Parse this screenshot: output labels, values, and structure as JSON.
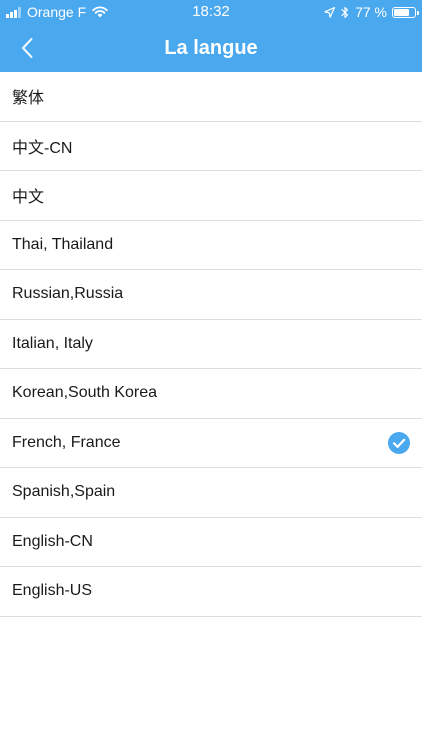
{
  "status_bar": {
    "carrier": "Orange F",
    "time": "18:32",
    "battery_percent": "77 %",
    "battery_level": 0.77,
    "icons": [
      "signal-bars-icon",
      "wifi-icon",
      "location-arrow-icon",
      "bluetooth-icon",
      "battery-icon"
    ]
  },
  "nav": {
    "back_icon": "chevron-left-icon",
    "title": "La langue"
  },
  "languages": [
    {
      "label": "繁体",
      "selected": false
    },
    {
      "label": "中文-CN",
      "selected": false
    },
    {
      "label": "中文",
      "selected": false
    },
    {
      "label": "Thai, Thailand",
      "selected": false
    },
    {
      "label": "Russian,Russia",
      "selected": false
    },
    {
      "label": "Italian, Italy",
      "selected": false
    },
    {
      "label": "Korean,South Korea",
      "selected": false
    },
    {
      "label": "French, France",
      "selected": true
    },
    {
      "label": "Spanish,Spain",
      "selected": false
    },
    {
      "label": "English-CN",
      "selected": false
    },
    {
      "label": "English-US",
      "selected": false
    }
  ],
  "colors": {
    "accent": "#4aa8ef",
    "divider": "#dedede",
    "text": "#1a1a1a"
  }
}
